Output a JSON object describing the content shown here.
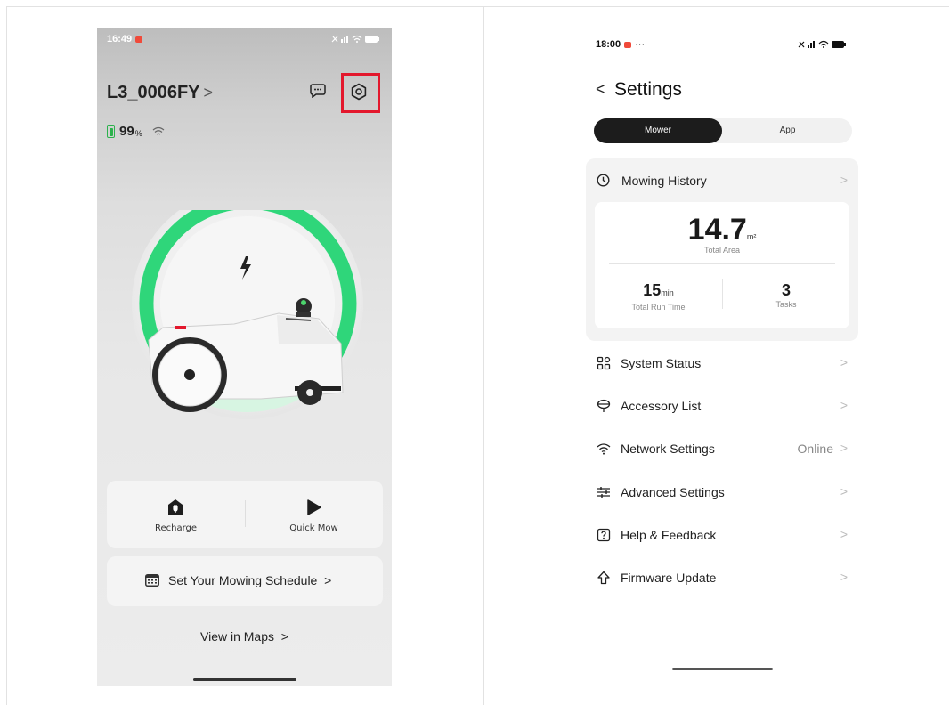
{
  "left_screen": {
    "status_bar": {
      "time": "16:49",
      "icons": "―ᵀⁿʟ ≡ ■"
    },
    "device_name": "L3_0006FY",
    "device_name_chevron": ">",
    "battery_percent": "99",
    "battery_unit": "%",
    "actions": {
      "recharge": "Recharge",
      "quick_mow": "Quick Mow"
    },
    "schedule_label": "Set Your Mowing Schedule",
    "schedule_chevron": ">",
    "maps_label": "View in Maps",
    "maps_chevron": ">",
    "highlight_color": "#e3182d",
    "progress_ring_color": "#2fd67a"
  },
  "right_screen": {
    "status_bar": {
      "time": "18:00",
      "dots": "···"
    },
    "back_glyph": "<",
    "title": "Settings",
    "tabs": {
      "active": "Mower",
      "inactive": "App"
    },
    "mowing_history": {
      "label": "Mowing History",
      "total_area_value": "14.7",
      "total_area_unit": "m²",
      "total_area_label": "Total Area",
      "run_time_value": "15",
      "run_time_unit": "min",
      "run_time_label": "Total Run Time",
      "tasks_value": "3",
      "tasks_label": "Tasks"
    },
    "menu": [
      {
        "icon": "grid-icon",
        "label": "System Status",
        "value": ""
      },
      {
        "icon": "accessory-icon",
        "label": "Accessory List",
        "value": ""
      },
      {
        "icon": "wifi-icon",
        "label": "Network Settings",
        "value": "Online"
      },
      {
        "icon": "sliders-icon",
        "label": "Advanced Settings",
        "value": ""
      },
      {
        "icon": "help-icon",
        "label": "Help & Feedback",
        "value": ""
      },
      {
        "icon": "upload-arrow-icon",
        "label": "Firmware Update",
        "value": ""
      }
    ],
    "chevron": ">"
  }
}
